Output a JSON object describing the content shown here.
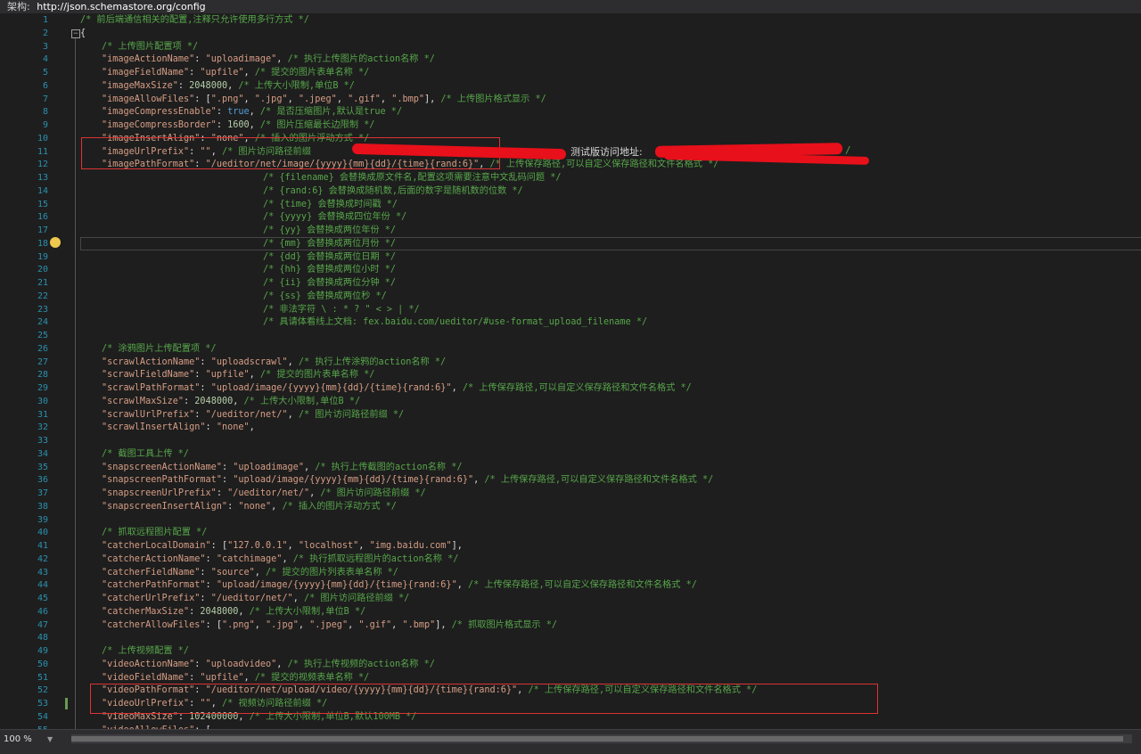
{
  "schema_bar": {
    "label": "架构:",
    "url": "http://json.schemastore.org/config"
  },
  "overlay_text": {
    "test_addr": "测试版访问地址:"
  },
  "zoom": {
    "value": "100 %"
  },
  "lines": [
    {
      "n": "1",
      "indent": 0,
      "tokens": [
        {
          "c": "cm",
          "t": "/* 前后端通信相关的配置,注释只允许使用多行方式 */"
        }
      ]
    },
    {
      "n": "2",
      "indent": 0,
      "tokens": [
        {
          "c": "punc",
          "t": "{"
        }
      ]
    },
    {
      "n": "3",
      "indent": 4,
      "tokens": [
        {
          "c": "cm",
          "t": "/* 上传图片配置项 */"
        }
      ]
    },
    {
      "n": "4",
      "indent": 4,
      "tokens": [
        {
          "c": "key",
          "t": "\"imageActionName\""
        },
        {
          "c": "punc",
          "t": ": "
        },
        {
          "c": "str",
          "t": "\"uploadimage\""
        },
        {
          "c": "punc",
          "t": ", "
        },
        {
          "c": "cm",
          "t": "/* 执行上传图片的action名称 */"
        }
      ]
    },
    {
      "n": "5",
      "indent": 4,
      "tokens": [
        {
          "c": "key",
          "t": "\"imageFieldName\""
        },
        {
          "c": "punc",
          "t": ": "
        },
        {
          "c": "str",
          "t": "\"upfile\""
        },
        {
          "c": "punc",
          "t": ", "
        },
        {
          "c": "cm",
          "t": "/* 提交的图片表单名称 */"
        }
      ]
    },
    {
      "n": "6",
      "indent": 4,
      "tokens": [
        {
          "c": "key",
          "t": "\"imageMaxSize\""
        },
        {
          "c": "punc",
          "t": ": "
        },
        {
          "c": "num",
          "t": "2048000"
        },
        {
          "c": "punc",
          "t": ", "
        },
        {
          "c": "cm",
          "t": "/* 上传大小限制,单位B */"
        }
      ]
    },
    {
      "n": "7",
      "indent": 4,
      "tokens": [
        {
          "c": "key",
          "t": "\"imageAllowFiles\""
        },
        {
          "c": "punc",
          "t": ": ["
        },
        {
          "c": "str",
          "t": "\".png\""
        },
        {
          "c": "punc",
          "t": ", "
        },
        {
          "c": "str",
          "t": "\".jpg\""
        },
        {
          "c": "punc",
          "t": ", "
        },
        {
          "c": "str",
          "t": "\".jpeg\""
        },
        {
          "c": "punc",
          "t": ", "
        },
        {
          "c": "str",
          "t": "\".gif\""
        },
        {
          "c": "punc",
          "t": ", "
        },
        {
          "c": "str",
          "t": "\".bmp\""
        },
        {
          "c": "punc",
          "t": "], "
        },
        {
          "c": "cm",
          "t": "/* 上传图片格式显示 */"
        }
      ]
    },
    {
      "n": "8",
      "indent": 4,
      "tokens": [
        {
          "c": "key",
          "t": "\"imageCompressEnable\""
        },
        {
          "c": "punc",
          "t": ": "
        },
        {
          "c": "kw",
          "t": "true"
        },
        {
          "c": "punc",
          "t": ", "
        },
        {
          "c": "cm",
          "t": "/* 是否压缩图片,默认是true */"
        }
      ]
    },
    {
      "n": "9",
      "indent": 4,
      "tokens": [
        {
          "c": "key",
          "t": "\"imageCompressBorder\""
        },
        {
          "c": "punc",
          "t": ": "
        },
        {
          "c": "num",
          "t": "1600"
        },
        {
          "c": "punc",
          "t": ", "
        },
        {
          "c": "cm",
          "t": "/* 图片压缩最长边限制 */"
        }
      ]
    },
    {
      "n": "10",
      "indent": 4,
      "tokens": [
        {
          "c": "key",
          "t": "\"imageInsertAlign\""
        },
        {
          "c": "punc",
          "t": ": "
        },
        {
          "c": "str",
          "t": "\"none\""
        },
        {
          "c": "punc",
          "t": ", "
        },
        {
          "c": "cm",
          "t": "/* 插入的图片浮动方式 */"
        }
      ]
    },
    {
      "n": "11",
      "indent": 4,
      "tokens": [
        {
          "c": "key",
          "t": "\"imageUrlPrefix\""
        },
        {
          "c": "punc",
          "t": ": "
        },
        {
          "c": "str",
          "t": "\"\""
        },
        {
          "c": "punc",
          "t": ", "
        },
        {
          "c": "cm",
          "t": "/* 图片访问路径前缀"
        }
      ]
    },
    {
      "n": "12",
      "indent": 4,
      "tokens": [
        {
          "c": "key",
          "t": "\"imagePathFormat\""
        },
        {
          "c": "punc",
          "t": ": "
        },
        {
          "c": "str",
          "t": "\"/ueditor/net/image/{yyyy}{mm}{dd}/{time}{rand:6}\""
        },
        {
          "c": "punc",
          "t": ", "
        },
        {
          "c": "cm",
          "t": "/* 上传保存路径,可以自定义保存路径和文件名格式 */"
        }
      ]
    },
    {
      "n": "13",
      "indent": 20,
      "tokens": [
        {
          "c": "cm",
          "t": "/* {filename} 会替换成原文件名,配置这项需要注意中文乱码问题 */"
        }
      ]
    },
    {
      "n": "14",
      "indent": 20,
      "tokens": [
        {
          "c": "cm",
          "t": "/* {rand:6} 会替换成随机数,后面的数字是随机数的位数 */"
        }
      ]
    },
    {
      "n": "15",
      "indent": 20,
      "tokens": [
        {
          "c": "cm",
          "t": "/* {time} 会替换成时间戳 */"
        }
      ]
    },
    {
      "n": "16",
      "indent": 20,
      "tokens": [
        {
          "c": "cm",
          "t": "/* {yyyy} 会替换成四位年份 */"
        }
      ]
    },
    {
      "n": "17",
      "indent": 20,
      "tokens": [
        {
          "c": "cm",
          "t": "/* {yy} 会替换成两位年份 */"
        }
      ]
    },
    {
      "n": "18",
      "indent": 20,
      "tokens": [
        {
          "c": "cm",
          "t": "/* {mm} 会替换成两位月份 */"
        }
      ]
    },
    {
      "n": "19",
      "indent": 20,
      "tokens": [
        {
          "c": "cm",
          "t": "/* {dd} 会替换成两位日期 */"
        }
      ]
    },
    {
      "n": "20",
      "indent": 20,
      "tokens": [
        {
          "c": "cm",
          "t": "/* {hh} 会替换成两位小时 */"
        }
      ]
    },
    {
      "n": "21",
      "indent": 20,
      "tokens": [
        {
          "c": "cm",
          "t": "/* {ii} 会替换成两位分钟 */"
        }
      ]
    },
    {
      "n": "22",
      "indent": 20,
      "tokens": [
        {
          "c": "cm",
          "t": "/* {ss} 会替换成两位秒 */"
        }
      ]
    },
    {
      "n": "23",
      "indent": 20,
      "tokens": [
        {
          "c": "cm",
          "t": "/* 非法字符 \\ : * ? \" < > | */"
        }
      ]
    },
    {
      "n": "24",
      "indent": 20,
      "tokens": [
        {
          "c": "cm",
          "t": "/* 具请体看线上文档: fex.baidu.com/ueditor/#use-format_upload_filename */"
        }
      ]
    },
    {
      "n": "25",
      "indent": 0,
      "tokens": []
    },
    {
      "n": "26",
      "indent": 4,
      "tokens": [
        {
          "c": "cm",
          "t": "/* 涂鸦图片上传配置项 */"
        }
      ]
    },
    {
      "n": "27",
      "indent": 4,
      "tokens": [
        {
          "c": "key",
          "t": "\"scrawlActionName\""
        },
        {
          "c": "punc",
          "t": ": "
        },
        {
          "c": "str",
          "t": "\"uploadscrawl\""
        },
        {
          "c": "punc",
          "t": ", "
        },
        {
          "c": "cm",
          "t": "/* 执行上传涂鸦的action名称 */"
        }
      ]
    },
    {
      "n": "28",
      "indent": 4,
      "tokens": [
        {
          "c": "key",
          "t": "\"scrawlFieldName\""
        },
        {
          "c": "punc",
          "t": ": "
        },
        {
          "c": "str",
          "t": "\"upfile\""
        },
        {
          "c": "punc",
          "t": ", "
        },
        {
          "c": "cm",
          "t": "/* 提交的图片表单名称 */"
        }
      ]
    },
    {
      "n": "29",
      "indent": 4,
      "tokens": [
        {
          "c": "key",
          "t": "\"scrawlPathFormat\""
        },
        {
          "c": "punc",
          "t": ": "
        },
        {
          "c": "str",
          "t": "\"upload/image/{yyyy}{mm}{dd}/{time}{rand:6}\""
        },
        {
          "c": "punc",
          "t": ", "
        },
        {
          "c": "cm",
          "t": "/* 上传保存路径,可以自定义保存路径和文件名格式 */"
        }
      ]
    },
    {
      "n": "30",
      "indent": 4,
      "tokens": [
        {
          "c": "key",
          "t": "\"scrawlMaxSize\""
        },
        {
          "c": "punc",
          "t": ": "
        },
        {
          "c": "num",
          "t": "2048000"
        },
        {
          "c": "punc",
          "t": ", "
        },
        {
          "c": "cm",
          "t": "/* 上传大小限制,单位B */"
        }
      ]
    },
    {
      "n": "31",
      "indent": 4,
      "tokens": [
        {
          "c": "key",
          "t": "\"scrawlUrlPrefix\""
        },
        {
          "c": "punc",
          "t": ": "
        },
        {
          "c": "str",
          "t": "\"/ueditor/net/\""
        },
        {
          "c": "punc",
          "t": ", "
        },
        {
          "c": "cm",
          "t": "/* 图片访问路径前缀 */"
        }
      ]
    },
    {
      "n": "32",
      "indent": 4,
      "tokens": [
        {
          "c": "key",
          "t": "\"scrawlInsertAlign\""
        },
        {
          "c": "punc",
          "t": ": "
        },
        {
          "c": "str",
          "t": "\"none\""
        },
        {
          "c": "punc",
          "t": ","
        }
      ]
    },
    {
      "n": "33",
      "indent": 0,
      "tokens": []
    },
    {
      "n": "34",
      "indent": 4,
      "tokens": [
        {
          "c": "cm",
          "t": "/* 截图工具上传 */"
        }
      ]
    },
    {
      "n": "35",
      "indent": 4,
      "tokens": [
        {
          "c": "key",
          "t": "\"snapscreenActionName\""
        },
        {
          "c": "punc",
          "t": ": "
        },
        {
          "c": "str",
          "t": "\"uploadimage\""
        },
        {
          "c": "punc",
          "t": ", "
        },
        {
          "c": "cm",
          "t": "/* 执行上传截图的action名称 */"
        }
      ]
    },
    {
      "n": "36",
      "indent": 4,
      "tokens": [
        {
          "c": "key",
          "t": "\"snapscreenPathFormat\""
        },
        {
          "c": "punc",
          "t": ": "
        },
        {
          "c": "str",
          "t": "\"upload/image/{yyyy}{mm}{dd}/{time}{rand:6}\""
        },
        {
          "c": "punc",
          "t": ", "
        },
        {
          "c": "cm",
          "t": "/* 上传保存路径,可以自定义保存路径和文件名格式 */"
        }
      ]
    },
    {
      "n": "37",
      "indent": 4,
      "tokens": [
        {
          "c": "key",
          "t": "\"snapscreenUrlPrefix\""
        },
        {
          "c": "punc",
          "t": ": "
        },
        {
          "c": "str",
          "t": "\"/ueditor/net/\""
        },
        {
          "c": "punc",
          "t": ", "
        },
        {
          "c": "cm",
          "t": "/* 图片访问路径前缀 */"
        }
      ]
    },
    {
      "n": "38",
      "indent": 4,
      "tokens": [
        {
          "c": "key",
          "t": "\"snapscreenInsertAlign\""
        },
        {
          "c": "punc",
          "t": ": "
        },
        {
          "c": "str",
          "t": "\"none\""
        },
        {
          "c": "punc",
          "t": ", "
        },
        {
          "c": "cm",
          "t": "/* 插入的图片浮动方式 */"
        }
      ]
    },
    {
      "n": "39",
      "indent": 0,
      "tokens": []
    },
    {
      "n": "40",
      "indent": 4,
      "tokens": [
        {
          "c": "cm",
          "t": "/* 抓取远程图片配置 */"
        }
      ]
    },
    {
      "n": "41",
      "indent": 4,
      "tokens": [
        {
          "c": "key",
          "t": "\"catcherLocalDomain\""
        },
        {
          "c": "punc",
          "t": ": ["
        },
        {
          "c": "str",
          "t": "\"127.0.0.1\""
        },
        {
          "c": "punc",
          "t": ", "
        },
        {
          "c": "str",
          "t": "\"localhost\""
        },
        {
          "c": "punc",
          "t": ", "
        },
        {
          "c": "str",
          "t": "\"img.baidu.com\""
        },
        {
          "c": "punc",
          "t": "],"
        }
      ]
    },
    {
      "n": "42",
      "indent": 4,
      "tokens": [
        {
          "c": "key",
          "t": "\"catcherActionName\""
        },
        {
          "c": "punc",
          "t": ": "
        },
        {
          "c": "str",
          "t": "\"catchimage\""
        },
        {
          "c": "punc",
          "t": ", "
        },
        {
          "c": "cm",
          "t": "/* 执行抓取远程图片的action名称 */"
        }
      ]
    },
    {
      "n": "43",
      "indent": 4,
      "tokens": [
        {
          "c": "key",
          "t": "\"catcherFieldName\""
        },
        {
          "c": "punc",
          "t": ": "
        },
        {
          "c": "str",
          "t": "\"source\""
        },
        {
          "c": "punc",
          "t": ", "
        },
        {
          "c": "cm",
          "t": "/* 提交的图片列表表单名称 */"
        }
      ]
    },
    {
      "n": "44",
      "indent": 4,
      "tokens": [
        {
          "c": "key",
          "t": "\"catcherPathFormat\""
        },
        {
          "c": "punc",
          "t": ": "
        },
        {
          "c": "str",
          "t": "\"upload/image/{yyyy}{mm}{dd}/{time}{rand:6}\""
        },
        {
          "c": "punc",
          "t": ", "
        },
        {
          "c": "cm",
          "t": "/* 上传保存路径,可以自定义保存路径和文件名格式 */"
        }
      ]
    },
    {
      "n": "45",
      "indent": 4,
      "tokens": [
        {
          "c": "key",
          "t": "\"catcherUrlPrefix\""
        },
        {
          "c": "punc",
          "t": ": "
        },
        {
          "c": "str",
          "t": "\"/ueditor/net/\""
        },
        {
          "c": "punc",
          "t": ", "
        },
        {
          "c": "cm",
          "t": "/* 图片访问路径前缀 */"
        }
      ]
    },
    {
      "n": "46",
      "indent": 4,
      "tokens": [
        {
          "c": "key",
          "t": "\"catcherMaxSize\""
        },
        {
          "c": "punc",
          "t": ": "
        },
        {
          "c": "num",
          "t": "2048000"
        },
        {
          "c": "punc",
          "t": ", "
        },
        {
          "c": "cm",
          "t": "/* 上传大小限制,单位B */"
        }
      ]
    },
    {
      "n": "47",
      "indent": 4,
      "tokens": [
        {
          "c": "key",
          "t": "\"catcherAllowFiles\""
        },
        {
          "c": "punc",
          "t": ": ["
        },
        {
          "c": "str",
          "t": "\".png\""
        },
        {
          "c": "punc",
          "t": ", "
        },
        {
          "c": "str",
          "t": "\".jpg\""
        },
        {
          "c": "punc",
          "t": ", "
        },
        {
          "c": "str",
          "t": "\".jpeg\""
        },
        {
          "c": "punc",
          "t": ", "
        },
        {
          "c": "str",
          "t": "\".gif\""
        },
        {
          "c": "punc",
          "t": ", "
        },
        {
          "c": "str",
          "t": "\".bmp\""
        },
        {
          "c": "punc",
          "t": "], "
        },
        {
          "c": "cm",
          "t": "/* 抓取图片格式显示 */"
        }
      ]
    },
    {
      "n": "48",
      "indent": 0,
      "tokens": []
    },
    {
      "n": "49",
      "indent": 4,
      "tokens": [
        {
          "c": "cm",
          "t": "/* 上传视频配置 */"
        }
      ]
    },
    {
      "n": "50",
      "indent": 4,
      "tokens": [
        {
          "c": "key",
          "t": "\"videoActionName\""
        },
        {
          "c": "punc",
          "t": ": "
        },
        {
          "c": "str",
          "t": "\"uploadvideo\""
        },
        {
          "c": "punc",
          "t": ", "
        },
        {
          "c": "cm",
          "t": "/* 执行上传视频的action名称 */"
        }
      ]
    },
    {
      "n": "51",
      "indent": 4,
      "tokens": [
        {
          "c": "key",
          "t": "\"videoFieldName\""
        },
        {
          "c": "punc",
          "t": ": "
        },
        {
          "c": "str",
          "t": "\"upfile\""
        },
        {
          "c": "punc",
          "t": ", "
        },
        {
          "c": "cm",
          "t": "/* 提交的视频表单名称 */"
        }
      ]
    },
    {
      "n": "52",
      "indent": 4,
      "tokens": [
        {
          "c": "key",
          "t": "\"videoPathFormat\""
        },
        {
          "c": "punc",
          "t": ": "
        },
        {
          "c": "str",
          "t": "\"/ueditor/net/upload/video/{yyyy}{mm}{dd}/{time}{rand:6}\""
        },
        {
          "c": "punc",
          "t": ", "
        },
        {
          "c": "cm",
          "t": "/* 上传保存路径,可以自定义保存路径和文件名格式 */"
        }
      ]
    },
    {
      "n": "53",
      "indent": 4,
      "tokens": [
        {
          "c": "key",
          "t": "\"videoUrlPrefix\""
        },
        {
          "c": "punc",
          "t": ": "
        },
        {
          "c": "str",
          "t": "\"\""
        },
        {
          "c": "punc",
          "t": ", "
        },
        {
          "c": "cm",
          "t": "/* 视频访问路径前缀 */"
        }
      ]
    },
    {
      "n": "54",
      "indent": 4,
      "tokens": [
        {
          "c": "key",
          "t": "\"videoMaxSize\""
        },
        {
          "c": "punc",
          "t": ": "
        },
        {
          "c": "num",
          "t": "102400000"
        },
        {
          "c": "punc",
          "t": ", "
        },
        {
          "c": "cm",
          "t": "/* 上传大小限制,单位B,默认100MB */"
        }
      ]
    },
    {
      "n": "55",
      "indent": 4,
      "tokens": [
        {
          "c": "key",
          "t": "\"videoAllowFiles\""
        },
        {
          "c": "punc",
          "t": ": ["
        }
      ]
    }
  ]
}
